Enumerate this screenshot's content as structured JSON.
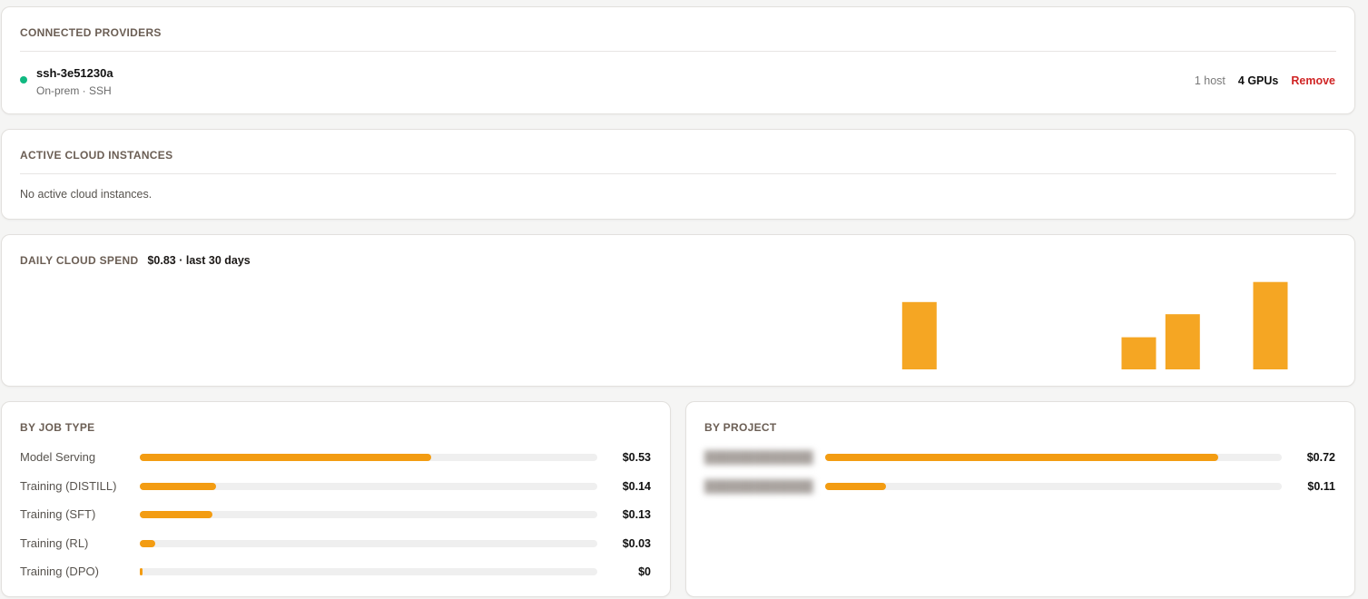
{
  "colors": {
    "status_active": "#10b981",
    "bar": "#f5a623",
    "fill": "#f39c12",
    "remove": "#d02525"
  },
  "providers": {
    "title": "CONNECTED PROVIDERS",
    "items": [
      {
        "name": "ssh-3e51230a",
        "subtitle": "On-prem · SSH",
        "status_icon": "green-dot-icon",
        "hosts": "1 host",
        "gpus": "4 GPUs",
        "remove_label": "Remove"
      }
    ]
  },
  "instances": {
    "title": "ACTIVE CLOUD INSTANCES",
    "empty_text": "No active cloud instances."
  },
  "spend": {
    "title": "DAILY CLOUD SPEND",
    "total": "$0.83 · last 30 days"
  },
  "chart_data": {
    "type": "bar",
    "title": "DAILY CLOUD SPEND",
    "days": 30,
    "values": [
      0,
      0,
      0,
      0,
      0,
      0,
      0,
      0,
      0,
      0,
      0,
      0,
      0,
      0,
      0,
      0,
      0,
      0,
      0,
      0,
      0.216,
      0,
      0,
      0,
      0,
      0.103,
      0.177,
      0,
      0.28,
      0
    ],
    "ylim": [
      0,
      0.32
    ],
    "grid": false
  },
  "by_job": {
    "title": "BY JOB TYPE",
    "rows": [
      {
        "label": "Model Serving",
        "value": "$0.53",
        "fraction": 0.637
      },
      {
        "label": "Training (DISTILL)",
        "value": "$0.14",
        "fraction": 0.166
      },
      {
        "label": "Training (SFT)",
        "value": "$0.13",
        "fraction": 0.158
      },
      {
        "label": "Training (RL)",
        "value": "$0.03",
        "fraction": 0.034
      },
      {
        "label": "Training (DPO)",
        "value": "$0",
        "fraction": 0.005
      }
    ]
  },
  "by_project": {
    "title": "BY PROJECT",
    "rows": [
      {
        "label": "",
        "value": "$0.72",
        "fraction": 0.86
      },
      {
        "label": "",
        "value": "$0.11",
        "fraction": 0.133
      }
    ]
  }
}
